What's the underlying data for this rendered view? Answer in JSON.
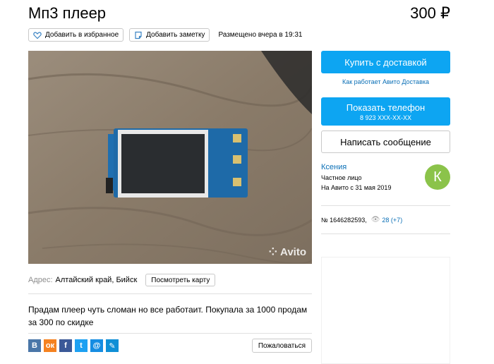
{
  "listing": {
    "title": "Мп3 плеер",
    "price": "300 ₽",
    "favorite_label": "Добавить в избранное",
    "note_label": "Добавить заметку",
    "posted": "Размещено вчера в 19:31",
    "watermark": "Avito",
    "address_label": "Адрес:",
    "address_value": "Алтайский край, Бийск",
    "map_button": "Посмотреть карту",
    "description": "Прадам плеер чуть сломан но все работаит. Покупала за 1000 продам за 300 по скидке",
    "complain_button": "Пожаловаться"
  },
  "social": [
    {
      "name": "vk-icon",
      "glyph": "В",
      "color": "#4a76a8"
    },
    {
      "name": "odnoklassniki-icon",
      "glyph": "ок",
      "color": "#f58220"
    },
    {
      "name": "facebook-icon",
      "glyph": "f",
      "color": "#3b5998"
    },
    {
      "name": "twitter-icon",
      "glyph": "t",
      "color": "#1da1f2"
    },
    {
      "name": "mail-icon",
      "glyph": "@",
      "color": "#168de2"
    },
    {
      "name": "livejournal-icon",
      "glyph": "✎",
      "color": "#0f8fd6"
    }
  ],
  "sidebar": {
    "buy_button": "Купить с доставкой",
    "delivery_link": "Как работает Авито Доставка",
    "phone_button": "Показать телефон",
    "phone_number": "8 923 XXX-XX-XX",
    "message_button": "Написать сообщение",
    "seller_name": "Ксения",
    "seller_type": "Частное лицо",
    "seller_since": "На Авито с 31 мая 2019",
    "avatar_letter": "К",
    "avatar_color": "#8bc34a",
    "ad_number": "№ 1646282593,",
    "views": "28 (+7)"
  },
  "colors": {
    "accent": "#0da5f2",
    "link": "#0a6fb6"
  }
}
